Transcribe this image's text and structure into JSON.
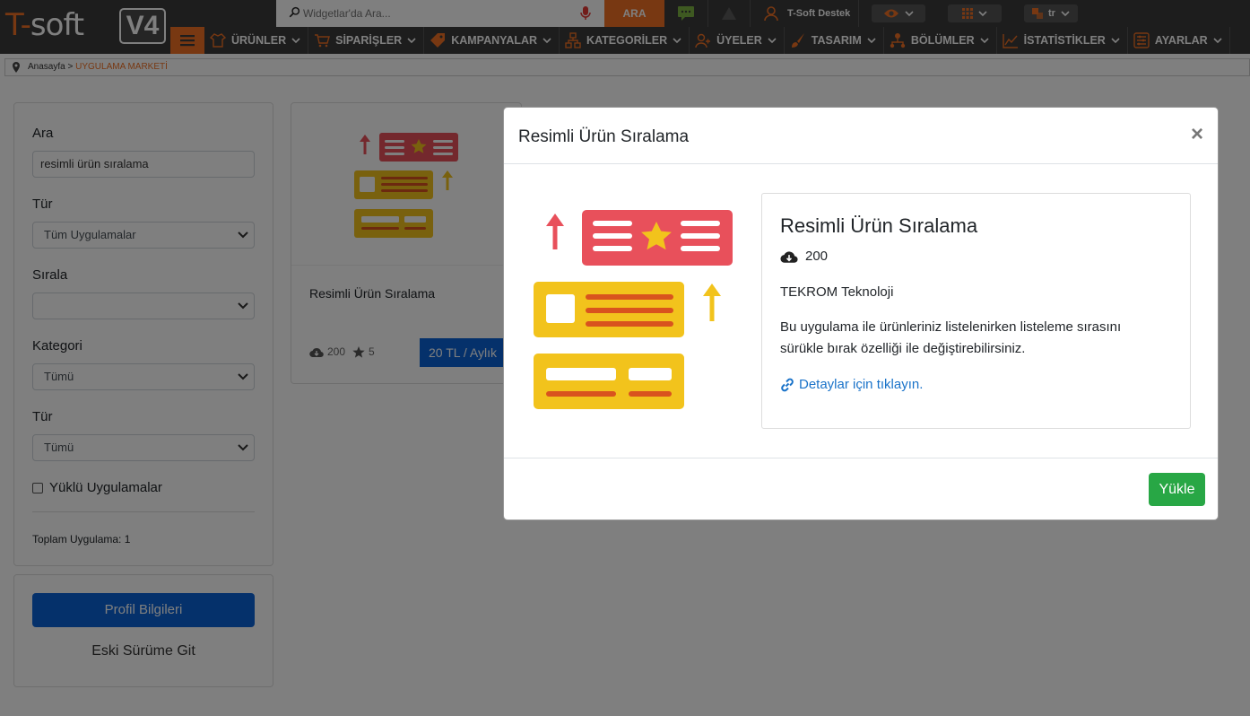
{
  "topbar": {
    "search_placeholder": "Widgetlar'da Ara...",
    "search_button": "ARA",
    "user_name": "T-Soft Destek",
    "language": "tr"
  },
  "logo": {
    "text_left": "T-",
    "text_right": "soft",
    "version": "V4"
  },
  "nav": {
    "items": [
      {
        "label": "ÜRÜNLER",
        "icon": "shirt-icon"
      },
      {
        "label": "SİPARİŞLER",
        "icon": "cart-icon"
      },
      {
        "label": "KAMPANYALAR",
        "icon": "tag-icon"
      },
      {
        "label": "KATEGORİLER",
        "icon": "sitemap-icon"
      },
      {
        "label": "ÜYELER",
        "icon": "users-icon"
      },
      {
        "label": "TASARIM",
        "icon": "brush-icon"
      },
      {
        "label": "BÖLÜMLER",
        "icon": "sections-icon"
      },
      {
        "label": "İSTATİSTİKLER",
        "icon": "chart-icon"
      },
      {
        "label": "AYARLAR",
        "icon": "settings-icon"
      }
    ]
  },
  "breadcrumb": {
    "home": "Anasayfa",
    "sep": " > ",
    "current": "UYGULAMA MARKETİ"
  },
  "filters": {
    "search_label": "Ara",
    "search_value": "resimli ürün sıralama",
    "type_label": "Tür",
    "type_value": "Tüm Uygulamalar",
    "sort_label": "Sırala",
    "sort_value": "",
    "category_label": "Kategori",
    "category_value": "Tümü",
    "type2_label": "Tür",
    "type2_value": "Tümü",
    "installed_label": "Yüklü Uygulamalar",
    "total_text": "Toplam Uygulama: 1"
  },
  "profile": {
    "button": "Profil Bilgileri",
    "old_version": "Eski Sürüme Git"
  },
  "app_card": {
    "title": "Resimli Ürün Sıralama",
    "downloads": "200",
    "rating": "5",
    "price_button": "20 TL / Aylık"
  },
  "modal": {
    "title": "Resimli Ürün Sıralama",
    "app_name": "Resimli Ürün Sıralama",
    "downloads": "200",
    "developer": "TEKROM Teknoloji",
    "description": "Bu uygulama ile ürünleriniz listelenirken listeleme sırasını sürükle bırak özelliği ile değiştirebilirsiniz.",
    "details_link": "Detaylar için tıklayın.",
    "close": "×",
    "install_button": "Yükle"
  },
  "colors": {
    "brand_orange": "#f07125",
    "bar_dark": "#3a3a3a",
    "primary_blue": "#0b63d6",
    "success_green": "#28a745",
    "link_blue": "#1a73c9"
  }
}
